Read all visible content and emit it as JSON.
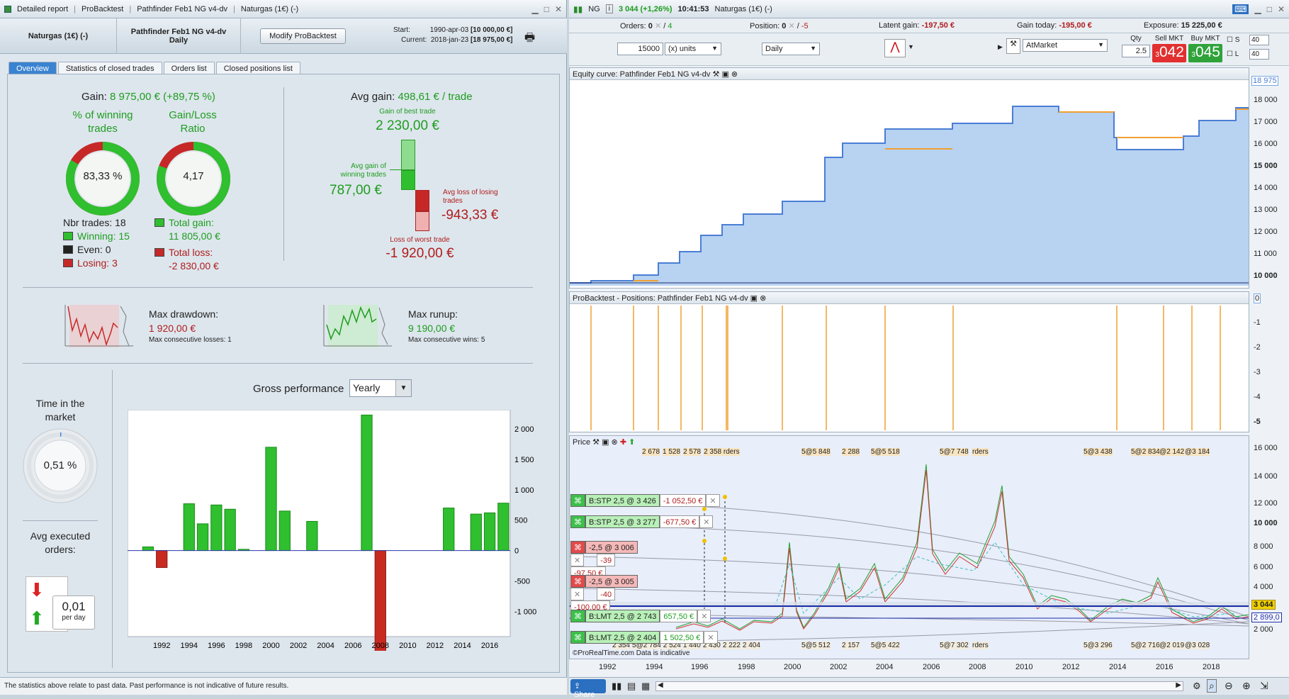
{
  "left_window": {
    "title_parts": [
      "Detailed report",
      "ProBacktest",
      "Pathfinder Feb1 NG v4-dv",
      "Naturgas (1€) (-)"
    ],
    "instrument": "Naturgas (1€) (-)",
    "strategy_name": "Pathfinder Feb1 NG v4-dv",
    "timeframe": "Daily",
    "modify_button": "Modify ProBacktest",
    "start_label": "Start:",
    "start_date": "1990-apr-03",
    "start_value": "[10 000,00 €]",
    "current_label": "Current:",
    "current_date": "2018-jan-23",
    "current_value": "[18 975,00 €]",
    "tabs": [
      "Overview",
      "Statistics of closed trades",
      "Orders list",
      "Closed positions list"
    ],
    "gain_label": "Gain:",
    "gain_value": "8 975,00 € (+89,75 %)",
    "pct_winning_title": "% of winning trades",
    "pct_winning_value": "83,33 %",
    "pct_winning": 0.8333,
    "gain_loss_title": "Gain/Loss Ratio",
    "gain_loss_value": "4,17",
    "gain_loss_fill": 0.8066,
    "nbr_trades": "Nbr trades: 18",
    "winning": "Winning: 15",
    "even": "Even: 0",
    "losing": "Losing: 3",
    "total_gain_label": "Total gain:",
    "total_gain": "11 805,00 €",
    "total_loss_label": "Total loss:",
    "total_loss": "-2 830,00 €",
    "avg_gain_label": "Avg gain:",
    "avg_gain_value": "498,61 € / trade",
    "best_trade_label": "Gain of best trade",
    "best_trade": "2 230,00 €",
    "avg_win_label": "Avg gain of winning trades",
    "avg_win": "787,00 €",
    "avg_loss_label": "Avg loss of losing trades",
    "avg_loss": "-943,33 €",
    "worst_trade_label": "Loss of worst trade",
    "worst_trade": "-1 920,00 €",
    "max_drawdown_label": "Max drawdown:",
    "max_drawdown": "1 920,00 €",
    "max_consec_losses": "Max consecutive losses: 1",
    "max_runup_label": "Max runup:",
    "max_runup": "9 190,00 €",
    "max_consec_wins": "Max consecutive wins: 5",
    "time_in_market_label": "Time in the market",
    "time_in_market": "0,51 %",
    "time_in_market_pct": 0.0051,
    "avg_orders_label": "Avg executed orders:",
    "avg_orders": "0,01",
    "avg_orders_unit": "per day",
    "gross_perf_label": "Gross performance",
    "gross_perf_select": "Yearly",
    "disclaimer": "The statistics above relate to past data. Past performance is not indicative of future results."
  },
  "chart_data": {
    "type": "bar",
    "title": "Gross performance",
    "categories": [
      1990,
      1991,
      1992,
      1993,
      1994,
      1995,
      1996,
      1997,
      1998,
      1999,
      2000,
      2001,
      2002,
      2003,
      2004,
      2005,
      2006,
      2007,
      2008,
      2009,
      2010,
      2011,
      2012,
      2013,
      2014,
      2015,
      2016,
      2017
    ],
    "values": [
      0,
      60,
      -280,
      0,
      770,
      440,
      750,
      680,
      20,
      0,
      1700,
      650,
      0,
      480,
      0,
      0,
      0,
      2230,
      -1920,
      0,
      0,
      0,
      0,
      700,
      0,
      600,
      620,
      780
    ],
    "ylim": [
      -1300,
      2200
    ],
    "yticks": [
      2000,
      1500,
      1000,
      500,
      0,
      -500,
      -1000
    ],
    "ytick_labels": [
      "2 000",
      "1 500",
      "1 000",
      "500",
      "0",
      "-500",
      "-1 000"
    ],
    "xtick_labels": [
      "1992",
      "1994",
      "1996",
      "1998",
      "2000",
      "2002",
      "2004",
      "2006",
      "2008",
      "2010",
      "2012",
      "2014",
      "2016"
    ],
    "positive_color": "#2fbf2f",
    "negative_color": "#c82a20"
  },
  "right_window": {
    "symbol": "NG",
    "price": "3 044 (+1,26%)",
    "time": "10:41:53",
    "instrument": "Naturgas (1€) (-)",
    "orders_label": "Orders:",
    "orders_value": "0",
    "orders_count": "4",
    "position_label": "Position:",
    "position_value": "0",
    "position_short": "-5",
    "latent_label": "Latent gain:",
    "latent_value": "-197,50 €",
    "gain_today_label": "Gain today:",
    "gain_today_value": "-195,00 €",
    "exposure_label": "Exposure:",
    "exposure_value": "15 225,00 €",
    "quantity": "15000",
    "units": "(x) units",
    "timeframe": "Daily",
    "order_type": "AtMarket",
    "qty_label": "Qty",
    "qty": "2.5",
    "sell_label": "Sell MKT",
    "sell_price": "042",
    "sell_prefix": "3",
    "buy_label": "Buy MKT",
    "buy_price": "045",
    "buy_prefix": "3",
    "s_label": "S",
    "s_val": "40",
    "l_label": "L",
    "l_val": "40",
    "equity_title": "Equity curve: Pathfinder Feb1 NG v4-dv",
    "equity_last": "18 975",
    "equity_yticks": [
      "18 000",
      "17 000",
      "16 000",
      "15 000",
      "14 000",
      "13 000",
      "12 000",
      "11 000",
      "10 000"
    ],
    "positions_title": "ProBacktest - Positions: Pathfinder Feb1 NG v4-dv",
    "positions_yticks": [
      "0",
      "-1",
      "-2",
      "-3",
      "-4",
      "-5"
    ],
    "price_title": "Price",
    "price_yticks": [
      "16 000",
      "14 000",
      "12 000",
      "10 000",
      "8 000",
      "6 000",
      "4 000",
      "2 000"
    ],
    "price_last": "3 044",
    "price_last2": "2 899,0",
    "top_annotations": [
      "2 678",
      "1 528",
      "2 578",
      "2 358 rders",
      "5@5 848",
      "2 288",
      "5@5 518",
      "5@7 748",
      "rders",
      "5@3 438",
      "5@2 834",
      "@2 142",
      "@3 184"
    ],
    "bottom_annotations": [
      "2 354",
      "5@2 784",
      "2 524",
      "1 440",
      "2 430",
      "2 222",
      "2 404",
      "5@5 512",
      "2 157",
      "5@5 422",
      "5@7 302",
      "rders",
      "5@3 296",
      "5@2 716",
      "@2 019",
      "@3 028"
    ],
    "orders": [
      {
        "label": "B:STP  2,5 @ 3 426",
        "pnl": "-1 052,50 €",
        "side": "buy"
      },
      {
        "label": "B:STP  2,5 @ 3 277",
        "pnl": "-677,50 €",
        "side": "buy"
      },
      {
        "label": "-2,5 @ 3 006",
        "pnl": "-97,50 €",
        "qty": "-39",
        "side": "sell"
      },
      {
        "label": "-2,5 @ 3 005",
        "pnl": "-100,00 €",
        "qty": "-40",
        "side": "sell"
      },
      {
        "label": "B:LMT  2,5 @ 2 743",
        "pnl": "657,50 €",
        "side": "buy"
      },
      {
        "label": "B:LMT  2,5 @ 2 404",
        "pnl": "1 502,50 €",
        "side": "buy"
      }
    ],
    "xaxis": [
      "1992",
      "1994",
      "1996",
      "1998",
      "2000",
      "2002",
      "2004",
      "2006",
      "2008",
      "2010",
      "2012",
      "2014",
      "2016",
      "2018"
    ],
    "copyright": "©ProRealTime.com Data is indicative",
    "share_label": "Share"
  }
}
